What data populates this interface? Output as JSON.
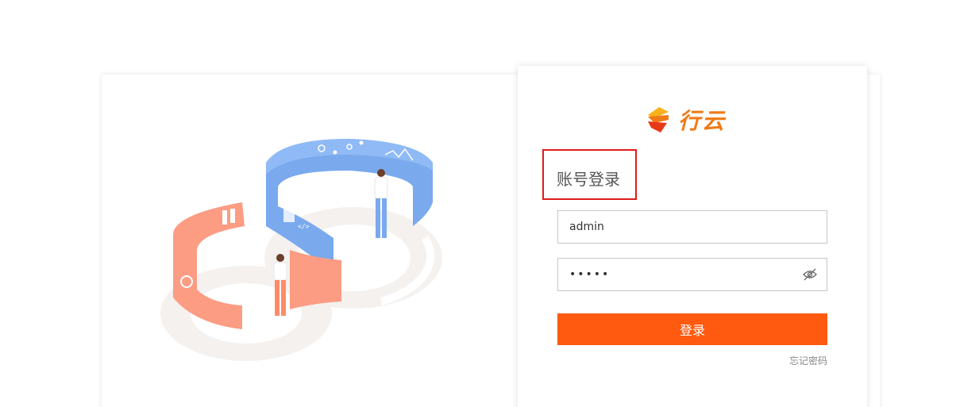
{
  "app": {
    "logo_text": "行云",
    "brand_color": "#f07a16"
  },
  "login": {
    "title": "账号登录",
    "username_value": "admin",
    "password_value": "•••••",
    "login_button": "登录",
    "forgot_password": "忘记密码",
    "button_color": "#ff5a0f",
    "highlight_color": "#e01b1b"
  },
  "icons": {
    "eye_toggle": "eye-off-icon",
    "logo_mark": "logo-icon"
  }
}
